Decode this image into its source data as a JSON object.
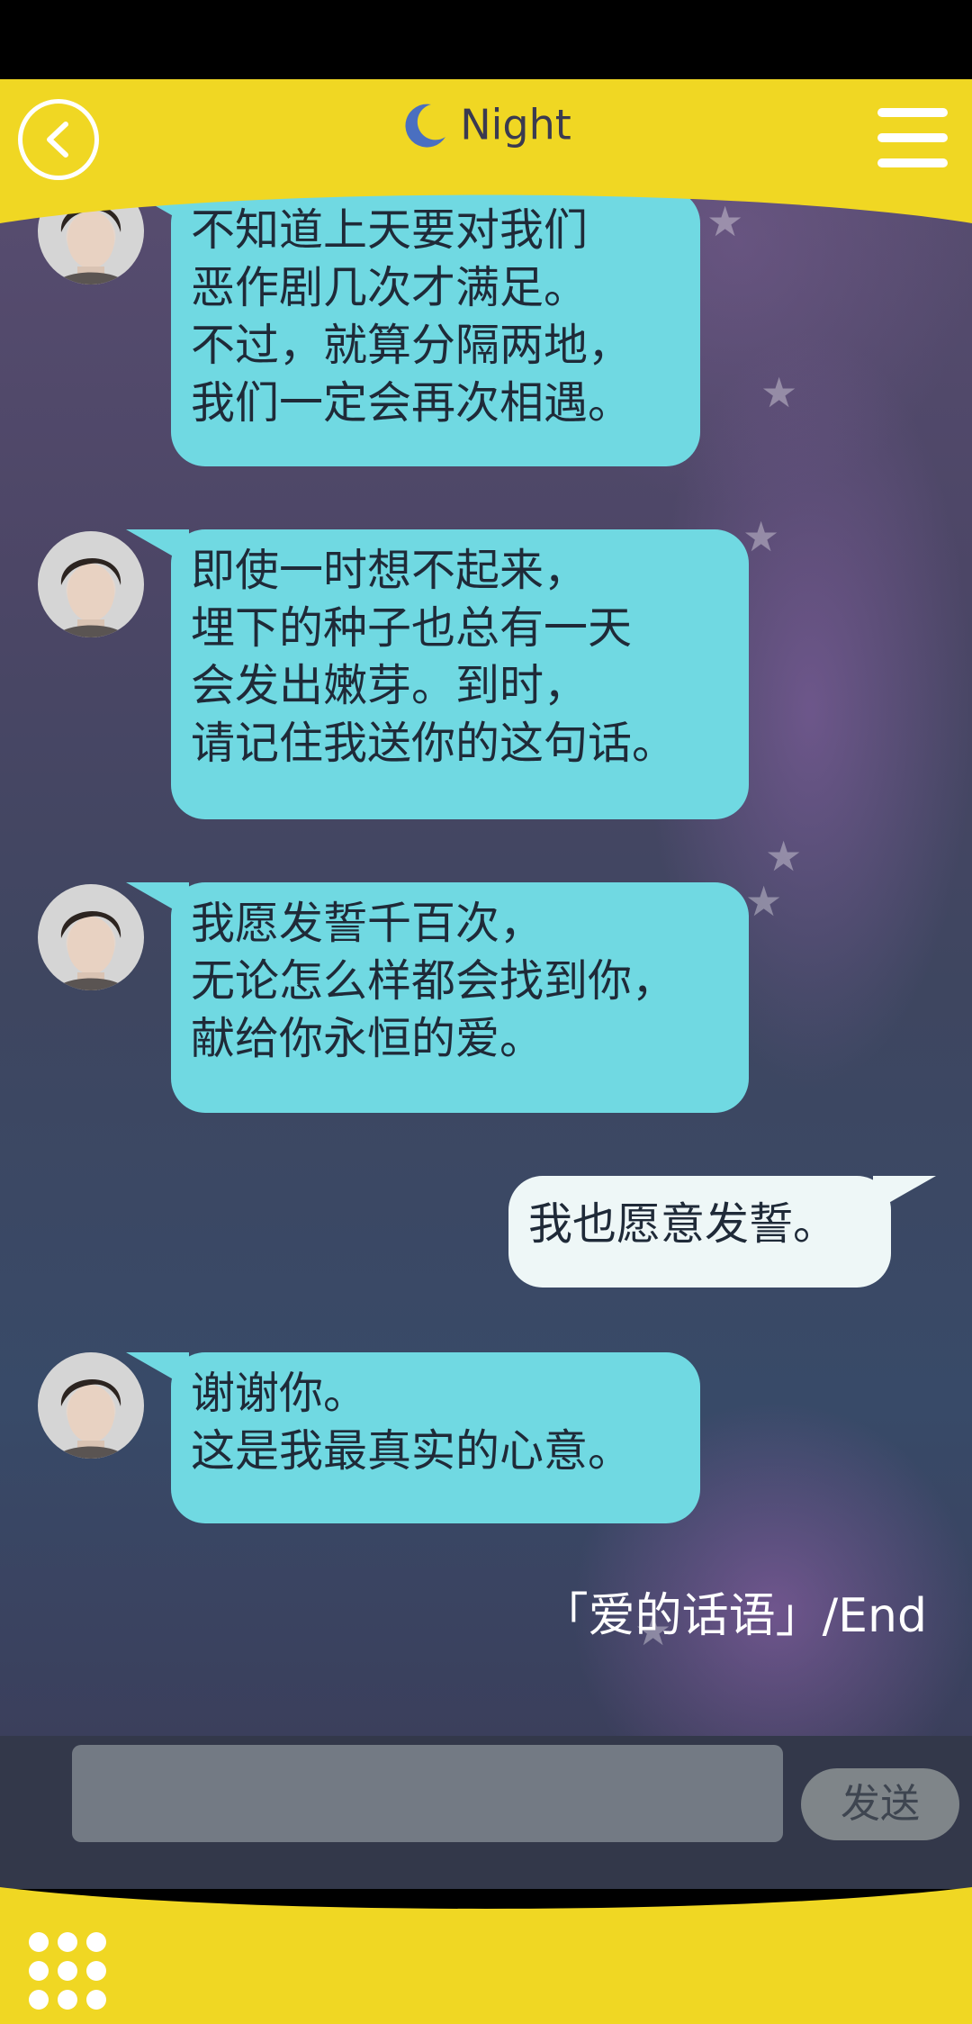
{
  "header": {
    "title": "Night",
    "colors": {
      "bar": "#f0d723",
      "moon": "#4a6fc0"
    }
  },
  "messages": [
    {
      "sender": "character",
      "text": "不知道上天要对我们\n恶作剧几次才满足。\n不过，就算分隔两地，\n我们一定会再次相遇。"
    },
    {
      "sender": "character",
      "text": "即使一时想不起来，\n埋下的种子也总有一天\n会发出嫩芽。到时，\n请记住我送你的这句话。"
    },
    {
      "sender": "character",
      "text": "我愿发誓千百次，\n无论怎么样都会找到你，\n献给你永恒的爱。"
    },
    {
      "sender": "user",
      "text": "我也愿意发誓。"
    },
    {
      "sender": "character",
      "text": "谢谢你。\n这是我最真实的心意。"
    }
  ],
  "ending_label": "「爱的话语」/End",
  "composer": {
    "input_value": "",
    "send_label": "发送"
  },
  "icons": {
    "back": "back-arrow-icon",
    "moon": "moon-icon",
    "menu": "hamburger-menu-icon",
    "grid": "grid-dots-icon"
  }
}
